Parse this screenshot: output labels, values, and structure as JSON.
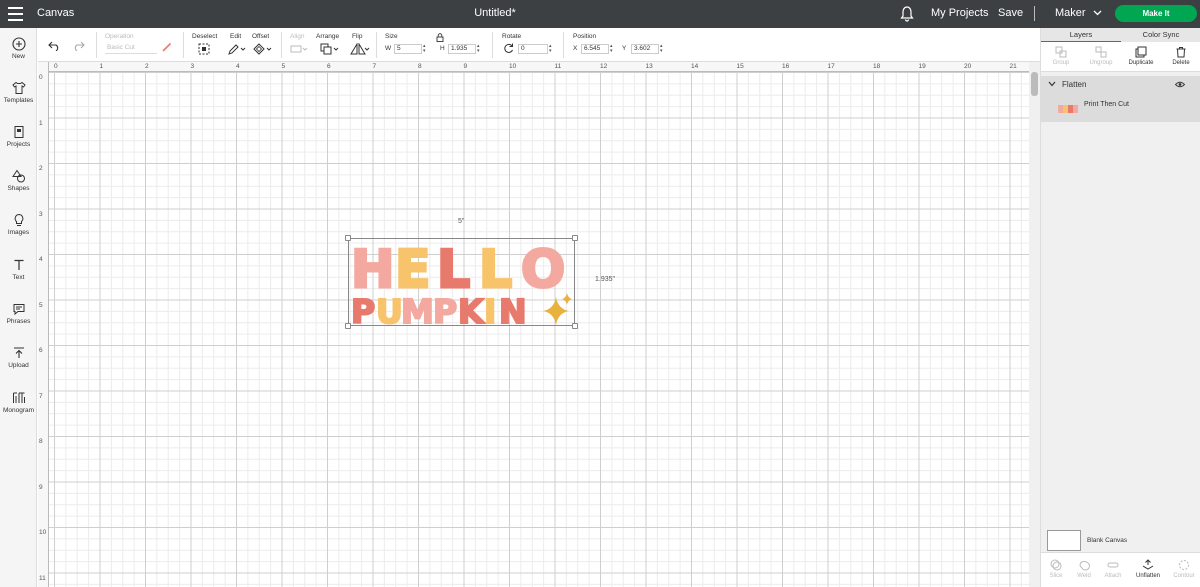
{
  "topbar": {
    "app_title": "Canvas",
    "doc_title": "Untitled*",
    "my_projects": "My Projects",
    "save": "Save",
    "machine": "Maker",
    "make_it": "Make It"
  },
  "sidebar": {
    "items": [
      {
        "label": "New",
        "icon": "plus-circle-icon"
      },
      {
        "label": "Templates",
        "icon": "shirt-icon"
      },
      {
        "label": "Projects",
        "icon": "projects-icon"
      },
      {
        "label": "Shapes",
        "icon": "shapes-icon"
      },
      {
        "label": "Images",
        "icon": "lightbulb-icon"
      },
      {
        "label": "Text",
        "icon": "text-icon"
      },
      {
        "label": "Phrases",
        "icon": "speech-bubble-icon"
      },
      {
        "label": "Upload",
        "icon": "upload-icon"
      },
      {
        "label": "Monogram",
        "icon": "monogram-icon"
      }
    ]
  },
  "toolbar": {
    "operation_label": "Operation",
    "operation_value": "Basic Cut",
    "deselect": "Deselect",
    "edit": "Edit",
    "offset": "Offset",
    "align": "Align",
    "arrange": "Arrange",
    "flip": "Flip",
    "size_label": "Size",
    "w_label": "W",
    "w_value": "5",
    "h_label": "H",
    "h_value": "1.935",
    "rotate_label": "Rotate",
    "rotate_value": "0",
    "position_label": "Position",
    "x_label": "X",
    "x_value": "6.545",
    "y_label": "Y",
    "y_value": "3.602"
  },
  "canvas": {
    "ruler_top": [
      "0",
      "1",
      "2",
      "3",
      "4",
      "5",
      "6",
      "7",
      "8",
      "9",
      "10",
      "11",
      "12",
      "13",
      "14",
      "15",
      "16",
      "17",
      "18",
      "19",
      "20",
      "21"
    ],
    "ruler_left": [
      "0",
      "1",
      "2",
      "3",
      "4",
      "5",
      "6",
      "7",
      "8",
      "9",
      "10",
      "11"
    ],
    "width_dim": "5\"",
    "height_dim": "1.935\"",
    "design_line1": "HELLO",
    "design_line2": "PUMPKIN"
  },
  "right_panel": {
    "tabs": [
      "Layers",
      "Color Sync"
    ],
    "actions": [
      "Group",
      "Ungroup",
      "Duplicate",
      "Delete"
    ],
    "layer_group": "Flatten",
    "layer_item": "Print Then Cut",
    "blank_canvas": "Blank Canvas",
    "bottom_actions": [
      "Slice",
      "Weld",
      "Attach",
      "Unflatten",
      "Contour"
    ]
  },
  "colors": {
    "topbar": "#3c4043",
    "make_it": "#00a651",
    "pink": "#f4a9a0",
    "yellow": "#f7c46c",
    "coral": "#e77a6c",
    "gold": "#e9b23f"
  }
}
